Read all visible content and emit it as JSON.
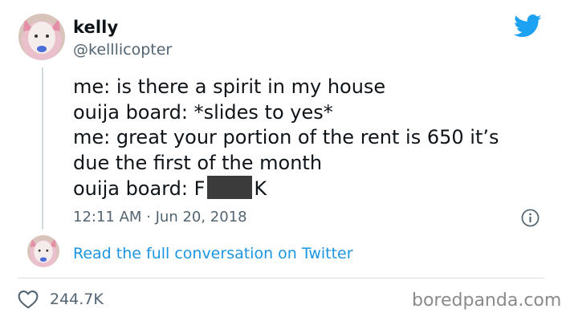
{
  "tweet": {
    "display_name": "kelly",
    "handle": "@kelllicopter",
    "lines": [
      "me: is there a spirit in my house",
      "ouija board: *slides to yes*",
      "me: great your portion of the rent is 650 it’s",
      "due the first of the month"
    ],
    "last_line_prefix": "ouija board: F",
    "last_line_suffix": "K",
    "timestamp": "12:11 AM · Jun 20, 2018",
    "read_more": "Read the full conversation on Twitter",
    "likes": "244.7K"
  },
  "icons": {
    "brand": "twitter-bird-icon",
    "info": "info-icon",
    "like": "heart-icon"
  },
  "colors": {
    "twitter_blue": "#1da1f2",
    "link_blue": "#1b95e0",
    "secondary_text": "#536471",
    "censor": "#3b3b3b"
  },
  "watermark": "boredpanda.com"
}
